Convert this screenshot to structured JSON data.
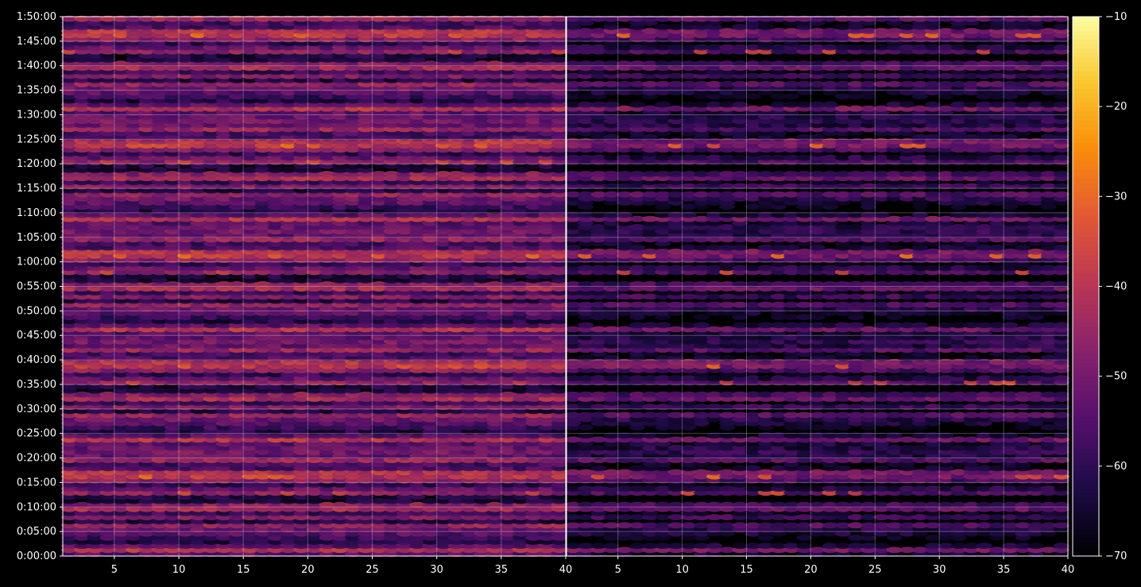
{
  "chart_data": {
    "type": "heatmap",
    "title": "",
    "xlabel": "",
    "ylabel": "",
    "background": "#000000",
    "grid": true,
    "colormap": "inferno",
    "panels": [
      {
        "name": "",
        "x_range": [
          1,
          40
        ],
        "x_ticks": [
          5,
          10,
          15,
          20,
          25,
          30,
          35,
          40
        ],
        "offset": 0
      },
      {
        "name": "",
        "x_range": [
          1,
          40
        ],
        "x_ticks": [
          5,
          10,
          15,
          20,
          25,
          30,
          35,
          40
        ],
        "offset": -10
      }
    ],
    "y_range_seconds": [
      0,
      6600
    ],
    "y_ticks": [
      "0:00:00",
      "0:05:00",
      "0:10:00",
      "0:15:00",
      "0:20:00",
      "0:25:00",
      "0:30:00",
      "0:35:00",
      "0:40:00",
      "0:45:00",
      "0:50:00",
      "0:55:00",
      "1:00:00",
      "1:05:00",
      "1:10:00",
      "1:15:00",
      "1:20:00",
      "1:25:00",
      "1:30:00",
      "1:35:00",
      "1:40:00",
      "1:45:00",
      "1:50:00"
    ],
    "colorbar": {
      "range": [
        -70,
        -10
      ],
      "ticks": [
        "−10",
        "−20",
        "−30",
        "−40",
        "−50",
        "−60",
        "−70"
      ],
      "tick_values": [
        -10,
        -20,
        -30,
        -40,
        -50,
        -60,
        -70
      ]
    },
    "bands": [
      {
        "t": 5,
        "v": -46,
        "hot": [
          [
            10,
            -36
          ]
        ]
      },
      {
        "t": 3,
        "v": -40,
        "hot": [
          [
            10,
            -30
          ],
          [
            39,
            -33
          ]
        ]
      },
      {
        "t": 2,
        "v": -44
      },
      {
        "t": 1,
        "v": -54
      },
      {
        "t": 0,
        "v": -58
      },
      {
        "t": -1,
        "v": -62
      },
      {
        "t": -2,
        "v": -47
      },
      {
        "t": -3,
        "v": -52
      },
      {
        "t": -4,
        "v": -40
      },
      {
        "t": -5,
        "v": -52
      },
      {
        "t": -6,
        "v": -40
      },
      {
        "t": -7,
        "v": -54
      },
      {
        "t": -8,
        "v": -48
      },
      {
        "t": -9,
        "v": -64
      },
      {
        "t": -10,
        "v": -60
      },
      {
        "t": -11,
        "v": -56
      },
      {
        "t": -12,
        "v": -50
      },
      {
        "t": -13,
        "v": -54
      },
      {
        "t": -14,
        "v": -51
      },
      {
        "t": -15,
        "v": -58
      },
      {
        "t": -16,
        "v": -63
      },
      {
        "t": -17,
        "v": -46
      },
      {
        "t": -18,
        "v": -57
      },
      {
        "t": -19,
        "v": -52
      },
      {
        "t": -20,
        "v": -62
      },
      {
        "t": -21,
        "v": -45
      },
      {
        "t": -22,
        "v": -42
      }
    ]
  }
}
